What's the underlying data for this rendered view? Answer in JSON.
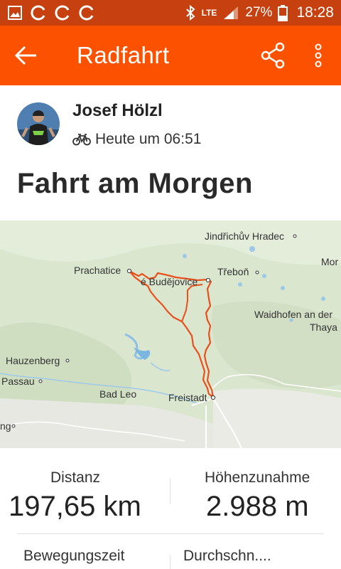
{
  "status_bar": {
    "network": "LTE",
    "battery": "27%",
    "time": "18:28"
  },
  "app_bar": {
    "title": "Radfahrt"
  },
  "activity": {
    "athlete_name": "Josef Hölzl",
    "timestamp": "Heute um 06:51",
    "title": "Fahrt am Morgen"
  },
  "map": {
    "labels": {
      "jindrichuv": "Jindřichův Hradec",
      "prachatice": "Prachatice",
      "budejovice": "é Budějovice",
      "trebon": "Třeboň",
      "mor": "Mor",
      "waidhofen1": "Waidhofen an der",
      "waidhofen2": "Thaya",
      "hauzenberg": "Hauzenberg",
      "passau": "Passau",
      "badleo": "Bad Leo",
      "freistadt": "Freistadt",
      "ng": "ng"
    }
  },
  "stats": {
    "distance_label": "Distanz",
    "distance_value": "197,65 km",
    "elevation_label": "Höhenzunahme",
    "elevation_value": "2.988 m",
    "moving_time_label": "Bewegungszeit",
    "average_label": "Durchschn...."
  },
  "colors": {
    "brand": "#fc5200",
    "status_bar": "#c6410f",
    "route": "#e8501c"
  }
}
